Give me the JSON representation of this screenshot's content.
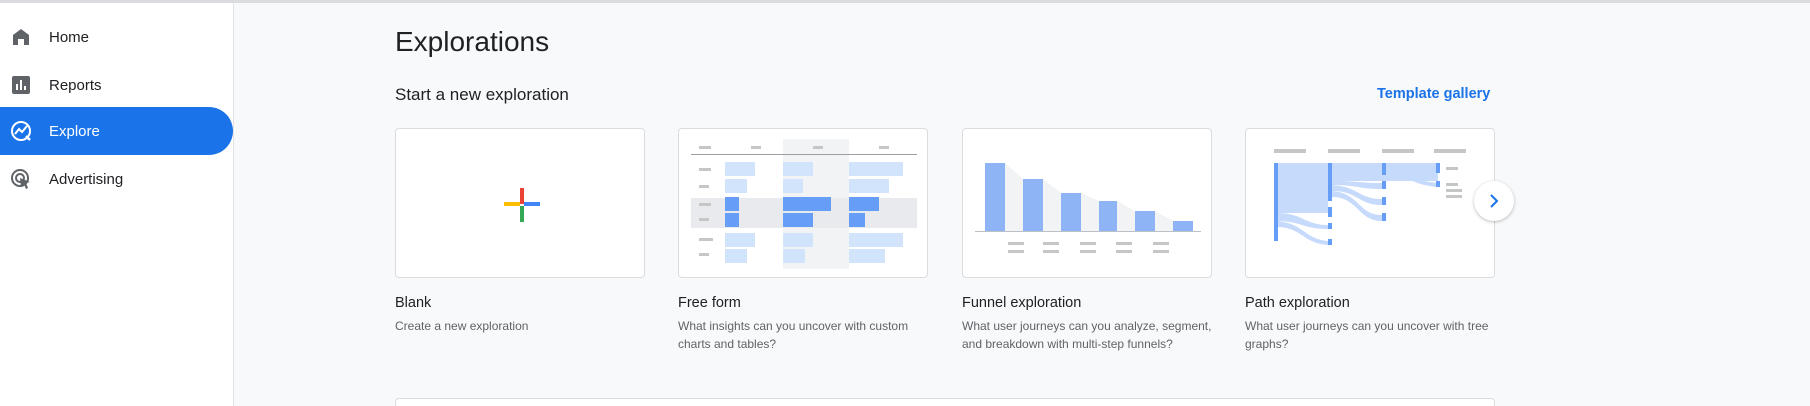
{
  "sidebar": {
    "items": [
      {
        "label": "Home",
        "icon": "home-icon"
      },
      {
        "label": "Reports",
        "icon": "reports-icon"
      },
      {
        "label": "Explore",
        "icon": "explore-icon",
        "active": true
      },
      {
        "label": "Advertising",
        "icon": "advertising-icon"
      }
    ]
  },
  "main": {
    "title": "Explorations",
    "section_title": "Start a new exploration",
    "template_gallery_label": "Template gallery",
    "cards": [
      {
        "name": "Blank",
        "desc": "Create a new exploration"
      },
      {
        "name": "Free form",
        "desc": "What insights can you uncover with custom charts and tables?"
      },
      {
        "name": "Funnel exploration",
        "desc": "What user journeys can you analyze, segment, and breakdown with multi-step funnels?"
      },
      {
        "name": "Path exploration",
        "desc": "What user journeys can you uncover with tree graphs?"
      }
    ]
  },
  "colors": {
    "accent": "#1a73e8",
    "thumb_bar": "#8fb4f5",
    "thumb_bar_dark": "#669df6",
    "thumb_light": "#d2e3fc",
    "thumb_gray": "#c4c7c5"
  }
}
